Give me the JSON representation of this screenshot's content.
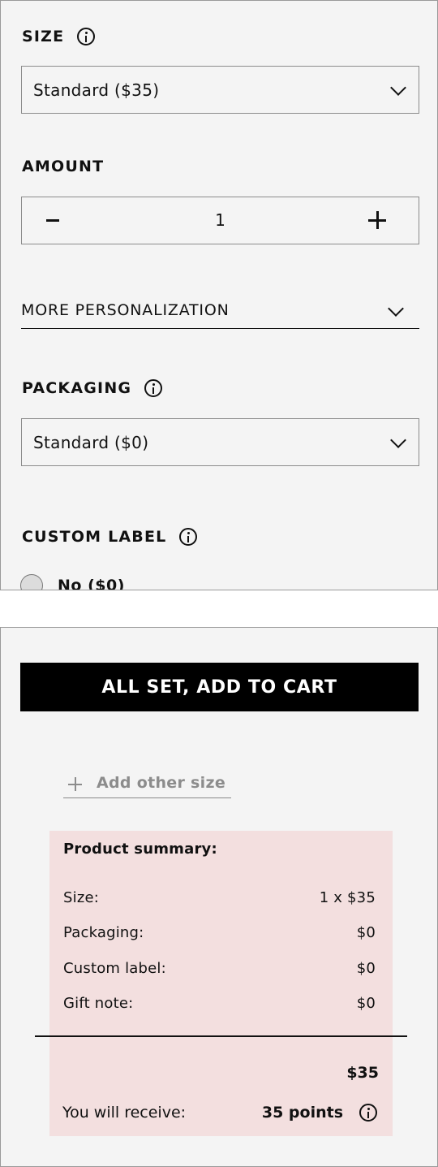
{
  "size": {
    "label": "SIZE",
    "selected": "Standard ($35)"
  },
  "amount": {
    "label": "AMOUNT",
    "minus": "–",
    "quantity": "1",
    "plus": "+"
  },
  "more_personalization": {
    "label": "MORE PERSONALIZATION"
  },
  "packaging": {
    "label": "PACKAGING",
    "selected": "Standard ($0)"
  },
  "custom_label": {
    "label": "CUSTOM LABEL",
    "options": [
      {
        "label": "No ($0)",
        "selected": false
      }
    ]
  },
  "cta": {
    "label": "ALL SET, ADD TO CART"
  },
  "add_other_size": {
    "label": "Add other size"
  },
  "summary": {
    "title": "Product summary:",
    "rows": [
      {
        "label": "Size:",
        "value": "1 x $35"
      },
      {
        "label": "Packaging:",
        "value": "$0"
      },
      {
        "label": "Custom label:",
        "value": "$0"
      },
      {
        "label": "Gift note:",
        "value": "$0"
      }
    ],
    "total": "$35",
    "points_label": "You will receive:",
    "points_value": "35 points"
  },
  "colors": {
    "panel_bg": "#f4f4f4",
    "summary_bg": "#f3dfdf",
    "cta_bg": "#000000",
    "muted_text": "#8c8c8c"
  }
}
